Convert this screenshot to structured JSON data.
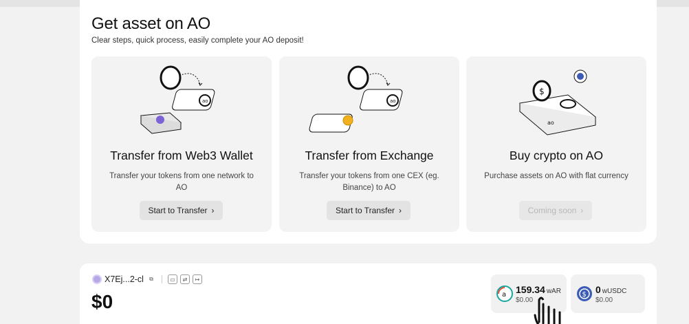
{
  "header": {
    "title": "Get asset on AO",
    "subtitle": "Clear steps, quick process, easily complete your AO deposit!"
  },
  "cards": [
    {
      "title": "Transfer from Web3 Wallet",
      "description": "Transfer your tokens from one network to AO",
      "button": "Start to Transfer",
      "button_icon": "chevron-right-icon",
      "enabled": true
    },
    {
      "title": "Transfer from Exchange",
      "description": "Transfer your tokens from one CEX (eg. Binance) to AO",
      "button": "Start to Transfer",
      "button_icon": "chevron-right-icon",
      "enabled": true
    },
    {
      "title": "Buy crypto on AO",
      "description": "Purchase assets on AO with flat currency",
      "button": "Coming soon",
      "button_icon": "chevron-right-icon",
      "enabled": false
    }
  ],
  "wallet": {
    "address": "X7Ej...2-cl",
    "balance": "$0",
    "icons": [
      "copy-icon",
      "wallet-icon",
      "swap-icon",
      "logout-icon"
    ]
  },
  "tokens": [
    {
      "amount": "159.34",
      "symbol": "wAR",
      "usd": "$0.00",
      "icon": "war-token-icon",
      "color": "#1aa6a0"
    },
    {
      "amount": "0",
      "symbol": "wUSDC",
      "usd": "$0.00",
      "icon": "usdc-token-icon",
      "color": "#3b5bb5"
    }
  ],
  "colors": {
    "card_bg": "#f3f3f3",
    "page_bg": "#f2f2f2",
    "accent_purple": "#7b63d6",
    "accent_orange": "#f2b01e"
  }
}
